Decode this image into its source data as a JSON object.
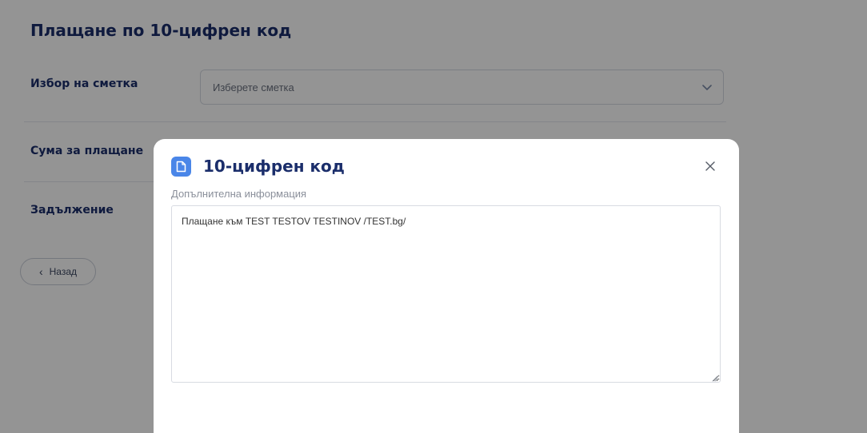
{
  "page": {
    "title": "Плащане по 10-цифрен код"
  },
  "form": {
    "account_label": "Избор на сметка",
    "account_placeholder": "Изберете сметка",
    "amount_label": "Сума за плащане",
    "obligation_label": "Задължение",
    "back_label": "Назад"
  },
  "modal": {
    "title": "10-цифрен код",
    "field_label": "Допълнителна информация",
    "field_value": "Плащане към TEST TESTOV TESTINOV /TEST.bg/"
  },
  "icons": {
    "select_chevron": "chevron-down-icon",
    "back_chevron": "chevron-left-icon",
    "modal_icon": "document-icon",
    "close": "close-icon"
  },
  "colors": {
    "heading": "#1b2e6b",
    "accent": "#4a86e8",
    "overlay": "rgba(0,0,0,0.42)"
  }
}
